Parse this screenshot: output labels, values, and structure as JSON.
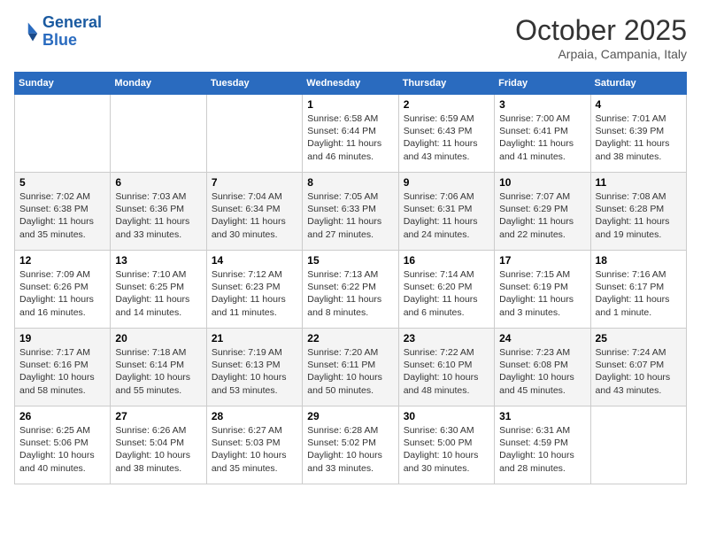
{
  "header": {
    "logo_line1": "General",
    "logo_line2": "Blue",
    "month": "October 2025",
    "location": "Arpaia, Campania, Italy"
  },
  "days_of_week": [
    "Sunday",
    "Monday",
    "Tuesday",
    "Wednesday",
    "Thursday",
    "Friday",
    "Saturday"
  ],
  "weeks": [
    [
      {
        "day": "",
        "info": ""
      },
      {
        "day": "",
        "info": ""
      },
      {
        "day": "",
        "info": ""
      },
      {
        "day": "1",
        "info": "Sunrise: 6:58 AM\nSunset: 6:44 PM\nDaylight: 11 hours and 46 minutes."
      },
      {
        "day": "2",
        "info": "Sunrise: 6:59 AM\nSunset: 6:43 PM\nDaylight: 11 hours and 43 minutes."
      },
      {
        "day": "3",
        "info": "Sunrise: 7:00 AM\nSunset: 6:41 PM\nDaylight: 11 hours and 41 minutes."
      },
      {
        "day": "4",
        "info": "Sunrise: 7:01 AM\nSunset: 6:39 PM\nDaylight: 11 hours and 38 minutes."
      }
    ],
    [
      {
        "day": "5",
        "info": "Sunrise: 7:02 AM\nSunset: 6:38 PM\nDaylight: 11 hours and 35 minutes."
      },
      {
        "day": "6",
        "info": "Sunrise: 7:03 AM\nSunset: 6:36 PM\nDaylight: 11 hours and 33 minutes."
      },
      {
        "day": "7",
        "info": "Sunrise: 7:04 AM\nSunset: 6:34 PM\nDaylight: 11 hours and 30 minutes."
      },
      {
        "day": "8",
        "info": "Sunrise: 7:05 AM\nSunset: 6:33 PM\nDaylight: 11 hours and 27 minutes."
      },
      {
        "day": "9",
        "info": "Sunrise: 7:06 AM\nSunset: 6:31 PM\nDaylight: 11 hours and 24 minutes."
      },
      {
        "day": "10",
        "info": "Sunrise: 7:07 AM\nSunset: 6:29 PM\nDaylight: 11 hours and 22 minutes."
      },
      {
        "day": "11",
        "info": "Sunrise: 7:08 AM\nSunset: 6:28 PM\nDaylight: 11 hours and 19 minutes."
      }
    ],
    [
      {
        "day": "12",
        "info": "Sunrise: 7:09 AM\nSunset: 6:26 PM\nDaylight: 11 hours and 16 minutes."
      },
      {
        "day": "13",
        "info": "Sunrise: 7:10 AM\nSunset: 6:25 PM\nDaylight: 11 hours and 14 minutes."
      },
      {
        "day": "14",
        "info": "Sunrise: 7:12 AM\nSunset: 6:23 PM\nDaylight: 11 hours and 11 minutes."
      },
      {
        "day": "15",
        "info": "Sunrise: 7:13 AM\nSunset: 6:22 PM\nDaylight: 11 hours and 8 minutes."
      },
      {
        "day": "16",
        "info": "Sunrise: 7:14 AM\nSunset: 6:20 PM\nDaylight: 11 hours and 6 minutes."
      },
      {
        "day": "17",
        "info": "Sunrise: 7:15 AM\nSunset: 6:19 PM\nDaylight: 11 hours and 3 minutes."
      },
      {
        "day": "18",
        "info": "Sunrise: 7:16 AM\nSunset: 6:17 PM\nDaylight: 11 hours and 1 minute."
      }
    ],
    [
      {
        "day": "19",
        "info": "Sunrise: 7:17 AM\nSunset: 6:16 PM\nDaylight: 10 hours and 58 minutes."
      },
      {
        "day": "20",
        "info": "Sunrise: 7:18 AM\nSunset: 6:14 PM\nDaylight: 10 hours and 55 minutes."
      },
      {
        "day": "21",
        "info": "Sunrise: 7:19 AM\nSunset: 6:13 PM\nDaylight: 10 hours and 53 minutes."
      },
      {
        "day": "22",
        "info": "Sunrise: 7:20 AM\nSunset: 6:11 PM\nDaylight: 10 hours and 50 minutes."
      },
      {
        "day": "23",
        "info": "Sunrise: 7:22 AM\nSunset: 6:10 PM\nDaylight: 10 hours and 48 minutes."
      },
      {
        "day": "24",
        "info": "Sunrise: 7:23 AM\nSunset: 6:08 PM\nDaylight: 10 hours and 45 minutes."
      },
      {
        "day": "25",
        "info": "Sunrise: 7:24 AM\nSunset: 6:07 PM\nDaylight: 10 hours and 43 minutes."
      }
    ],
    [
      {
        "day": "26",
        "info": "Sunrise: 6:25 AM\nSunset: 5:06 PM\nDaylight: 10 hours and 40 minutes."
      },
      {
        "day": "27",
        "info": "Sunrise: 6:26 AM\nSunset: 5:04 PM\nDaylight: 10 hours and 38 minutes."
      },
      {
        "day": "28",
        "info": "Sunrise: 6:27 AM\nSunset: 5:03 PM\nDaylight: 10 hours and 35 minutes."
      },
      {
        "day": "29",
        "info": "Sunrise: 6:28 AM\nSunset: 5:02 PM\nDaylight: 10 hours and 33 minutes."
      },
      {
        "day": "30",
        "info": "Sunrise: 6:30 AM\nSunset: 5:00 PM\nDaylight: 10 hours and 30 minutes."
      },
      {
        "day": "31",
        "info": "Sunrise: 6:31 AM\nSunset: 4:59 PM\nDaylight: 10 hours and 28 minutes."
      },
      {
        "day": "",
        "info": ""
      }
    ]
  ]
}
